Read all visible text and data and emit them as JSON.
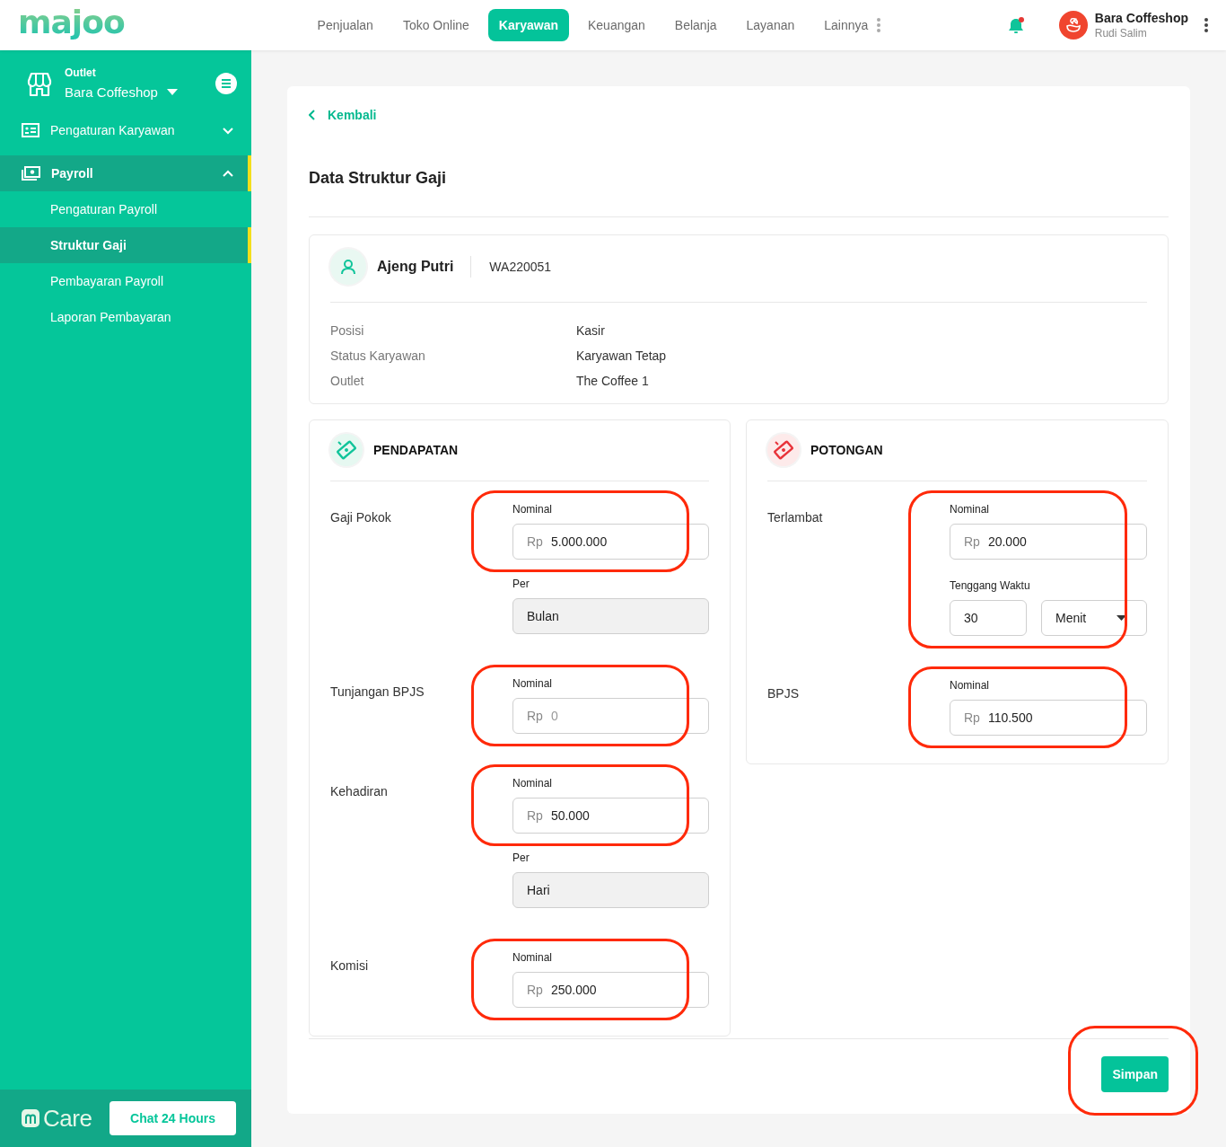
{
  "brand": {
    "logo": "majoo"
  },
  "nav": [
    {
      "label": "Penjualan",
      "selected": false,
      "kind": "tab"
    },
    {
      "label": "Toko Online",
      "selected": false,
      "kind": "tab"
    },
    {
      "label": "Karyawan",
      "selected": true,
      "kind": "tab"
    },
    {
      "label": "Keuangan",
      "selected": false,
      "kind": "tab"
    },
    {
      "label": "Belanja",
      "selected": false,
      "kind": "tab"
    },
    {
      "label": "Layanan",
      "selected": false,
      "kind": "tab"
    },
    {
      "label": "Lainnya",
      "selected": false,
      "kind": "more"
    }
  ],
  "notifications": {
    "unread": true
  },
  "account": {
    "name": "Bara Coffeshop",
    "user": "Rudi Salim"
  },
  "sidebar": {
    "outlet_label": "Outlet",
    "outlet_name": "Bara Coffeshop",
    "items": [
      {
        "label": "Pengaturan Karyawan",
        "kind": "people",
        "expanded": false,
        "selected": false
      },
      {
        "label": "Payroll",
        "kind": "money",
        "expanded": true,
        "selected": true,
        "children": [
          {
            "label": "Pengaturan Payroll",
            "selected": false
          },
          {
            "label": "Struktur Gaji",
            "selected": true
          },
          {
            "label": "Pembayaran Payroll",
            "selected": false
          },
          {
            "label": "Laporan Pembayaran",
            "selected": false
          }
        ]
      }
    ]
  },
  "care": {
    "brand": "Care",
    "button": "Chat 24 Hours"
  },
  "page": {
    "back": "Kembali",
    "title": "Data Struktur Gaji"
  },
  "employee": {
    "name": "Ajeng Putri",
    "code": "WA220051",
    "details": [
      {
        "label": "Posisi",
        "value": "Kasir"
      },
      {
        "label": "Status Karyawan",
        "value": "Karyawan Tetap"
      },
      {
        "label": "Outlet",
        "value": "The Coffee 1"
      }
    ]
  },
  "sections": [
    {
      "kind": "earning",
      "title": "PENDAPATAN",
      "rows": [
        {
          "label": "Gaji Pokok",
          "highlighted": true,
          "fields": [
            {
              "kind": "money",
              "label": "Nominal",
              "prefix": "Rp",
              "value": "5.000.000"
            }
          ],
          "per": {
            "label": "Per",
            "value": "Bulan"
          }
        },
        {
          "label": "Tunjangan BPJS",
          "highlighted": true,
          "fields": [
            {
              "kind": "money",
              "label": "Nominal",
              "prefix": "Rp",
              "placeholder": "0"
            }
          ]
        },
        {
          "label": "Kehadiran",
          "highlighted": true,
          "fields": [
            {
              "kind": "money",
              "label": "Nominal",
              "prefix": "Rp",
              "value": "50.000"
            }
          ],
          "per": {
            "label": "Per",
            "value": "Hari"
          }
        },
        {
          "label": "Komisi",
          "highlighted": true,
          "fields": [
            {
              "kind": "money",
              "label": "Nominal",
              "prefix": "Rp",
              "value": "250.000"
            }
          ]
        }
      ]
    },
    {
      "kind": "deduction",
      "title": "POTONGAN",
      "rows": [
        {
          "label": "Terlambat",
          "highlighted": true,
          "fields": [
            {
              "kind": "money",
              "label": "Nominal",
              "prefix": "Rp",
              "value": "20.000"
            },
            {
              "kind": "duration",
              "label": "Tenggang Waktu",
              "value": "30",
              "unit": "Menit"
            }
          ]
        },
        {
          "label": "BPJS",
          "highlighted": true,
          "fields": [
            {
              "kind": "money",
              "label": "Nominal",
              "prefix": "Rp",
              "value": "110.500"
            }
          ]
        }
      ]
    }
  ],
  "save_button": {
    "label": "Simpan",
    "highlighted": true
  }
}
